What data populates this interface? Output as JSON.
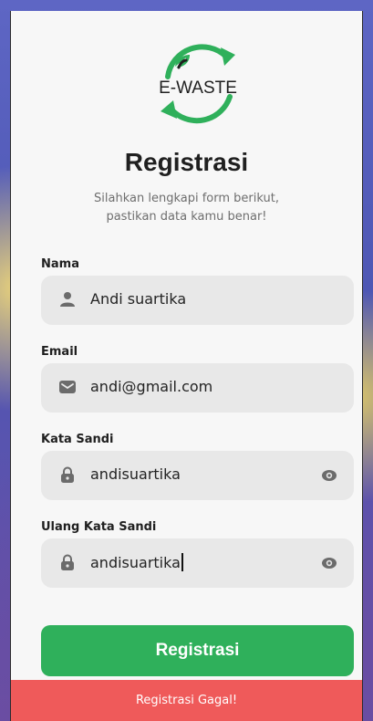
{
  "logo": {
    "text": "E-WASTE"
  },
  "header": {
    "title": "Registrasi",
    "subtitle_line1": "Silahkan lengkapi form berikut,",
    "subtitle_line2": "pastikan data kamu benar!"
  },
  "form": {
    "name": {
      "label": "Nama",
      "value": "Andi suartika",
      "icon": "user-icon"
    },
    "email": {
      "label": "Email",
      "value": "andi@gmail.com",
      "icon": "mail-icon"
    },
    "password": {
      "label": "Kata Sandi",
      "value": "andisuartika",
      "icon": "lock-icon"
    },
    "confirm_password": {
      "label": "Ulang Kata Sandi",
      "value": "andisuartika",
      "icon": "lock-icon"
    }
  },
  "actions": {
    "register_label": "Registrasi"
  },
  "toast": {
    "message": "Registrasi Gagal!"
  },
  "colors": {
    "accent": "#2fb05b",
    "error": "#ef5a5a",
    "field_bg": "#e8e8e8",
    "card_bg": "#f7f7f7"
  }
}
